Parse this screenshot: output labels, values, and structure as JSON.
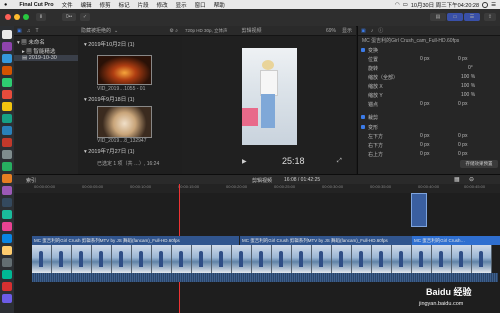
{
  "menubar": {
    "app_name": "Final Cut Pro",
    "menu_items": [
      "文件",
      "编辑",
      "修剪",
      "标记",
      "片段",
      "修改",
      "显示",
      "窗口",
      "帮助"
    ],
    "clock": "10月30日 周三下午04:20:28"
  },
  "titlebar": {
    "keyword_button": "0•• "
  },
  "library": {
    "tabs_icon_count": 3,
    "items": [
      {
        "label": "未命名"
      },
      {
        "label": "智能精选"
      },
      {
        "label": "2019-10-30"
      }
    ]
  },
  "browser": {
    "filter": "隐藏被拒绝的",
    "groups": [
      {
        "date": "2019年10月2日",
        "count": "(1)",
        "clip": "VID_2019…1055 - 01"
      },
      {
        "date": "2019年9月18日",
        "count": "(1)",
        "clip": "VID_2019…8_132947"
      },
      {
        "date": "2019年7月27日",
        "count": "(1)",
        "clip": ""
      }
    ],
    "status": "已选定 1 项（共 …）, 16:24"
  },
  "viewer": {
    "format": "720p HD 30p, 立体声",
    "title": "剪辑视频",
    "zoom": "69%",
    "view": "显示",
    "timecode": "25:18"
  },
  "inspector": {
    "clip_name": "MC 蛋吉利的Girl Crush_cam_Full-HD.60fps",
    "sections": [
      {
        "name": "变换",
        "rows": [
          {
            "label": "位置",
            "x": "0 px",
            "y": "0 px"
          },
          {
            "label": "旋转",
            "value": "0°"
          },
          {
            "label": "缩放（全部）",
            "value": "100 %"
          },
          {
            "label": "缩放 X",
            "value": "100 %"
          },
          {
            "label": "缩放 Y",
            "value": "100 %"
          },
          {
            "label": "锚点",
            "x": "0 px",
            "y": "0 px"
          }
        ]
      },
      {
        "name": "裁剪",
        "rows": []
      },
      {
        "name": "变形",
        "rows": [
          {
            "label": "左下方",
            "x": "0 px",
            "y": "0 px"
          },
          {
            "label": "右下方",
            "x": "0 px",
            "y": "0 px"
          },
          {
            "label": "右上方",
            "x": "0 px",
            "y": "0 px"
          }
        ]
      }
    ],
    "save_button": "存储效果预置"
  },
  "timeline": {
    "index_label": "索引",
    "title": "剪辑视频",
    "duration": "16:08 / 01:42:25",
    "ruler_ticks": [
      "00:00:00:00",
      "00:00:05:00",
      "00:00:10:00",
      "00:00:15:00",
      "00:00:20:00",
      "00:00:25:00",
      "00:00:30:00",
      "00:00:35:00",
      "00:00:40:00",
      "00:00:45:00"
    ],
    "clip_label_1": "MC 蛋吉利的Girl Crush 剪辑系列MTV by JS 舞蹈(fancam)_Full-HD.60fps",
    "clip_label_2": "MC 蛋吉利的Girl Crush 剪辑系列MTV by JS 舞蹈(fancam)_Full-HD.60fps",
    "clip_label_3": "MC 蛋吉利的Girl Crush…",
    "watermark": "Baidu 经验",
    "watermark_url": "jingyan.baidu.com"
  },
  "colors": {
    "accent": "#3b7be8",
    "clip_blue": "#31558e",
    "playhead": "#e33333"
  }
}
